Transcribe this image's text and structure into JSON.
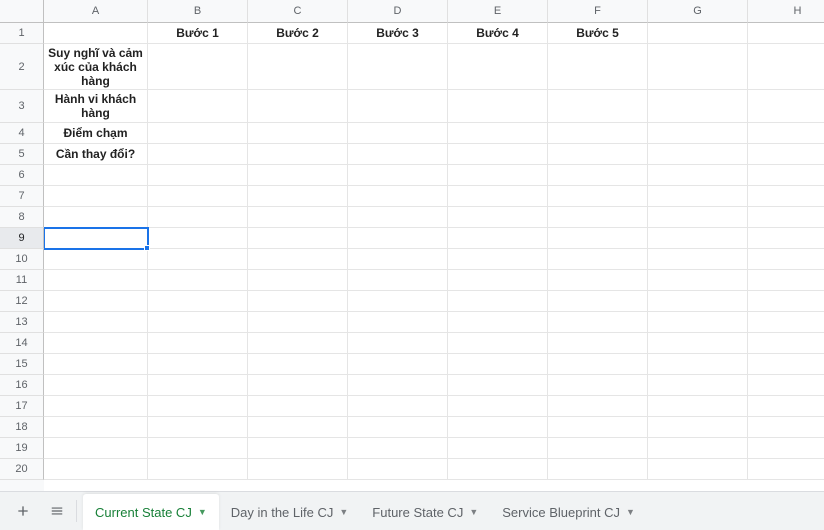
{
  "columns": [
    {
      "letter": "A",
      "width": 104
    },
    {
      "letter": "B",
      "width": 100
    },
    {
      "letter": "C",
      "width": 100
    },
    {
      "letter": "D",
      "width": 100
    },
    {
      "letter": "E",
      "width": 100
    },
    {
      "letter": "F",
      "width": 100
    },
    {
      "letter": "G",
      "width": 100
    },
    {
      "letter": "H",
      "width": 100
    }
  ],
  "rows": [
    {
      "n": 1,
      "height": 21
    },
    {
      "n": 2,
      "height": 46
    },
    {
      "n": 3,
      "height": 33
    },
    {
      "n": 4,
      "height": 21
    },
    {
      "n": 5,
      "height": 21
    },
    {
      "n": 6,
      "height": 21
    },
    {
      "n": 7,
      "height": 21
    },
    {
      "n": 8,
      "height": 21
    },
    {
      "n": 9,
      "height": 21
    },
    {
      "n": 10,
      "height": 21
    },
    {
      "n": 11,
      "height": 21
    },
    {
      "n": 12,
      "height": 21
    },
    {
      "n": 13,
      "height": 21
    },
    {
      "n": 14,
      "height": 21
    },
    {
      "n": 15,
      "height": 21
    },
    {
      "n": 16,
      "height": 21
    },
    {
      "n": 17,
      "height": 21
    },
    {
      "n": 18,
      "height": 21
    },
    {
      "n": 19,
      "height": 21
    },
    {
      "n": 20,
      "height": 21
    }
  ],
  "cells": {
    "r1c2": "Bước 1",
    "r1c3": "Bước 2",
    "r1c4": "Bước 3",
    "r1c5": "Bước 4",
    "r1c6": "Bước 5",
    "r2c1": "Suy nghĩ và cảm xúc của khách hàng",
    "r3c1": "Hành vi khách hàng",
    "r4c1": "Điểm chạm",
    "r5c1": "Cần thay đổi?"
  },
  "selection": {
    "row": 9,
    "col": 1
  },
  "tabs": [
    {
      "label": "Current State CJ",
      "active": true
    },
    {
      "label": "Day in the Life CJ",
      "active": false
    },
    {
      "label": "Future State CJ",
      "active": false
    },
    {
      "label": "Service Blueprint CJ",
      "active": false
    }
  ]
}
